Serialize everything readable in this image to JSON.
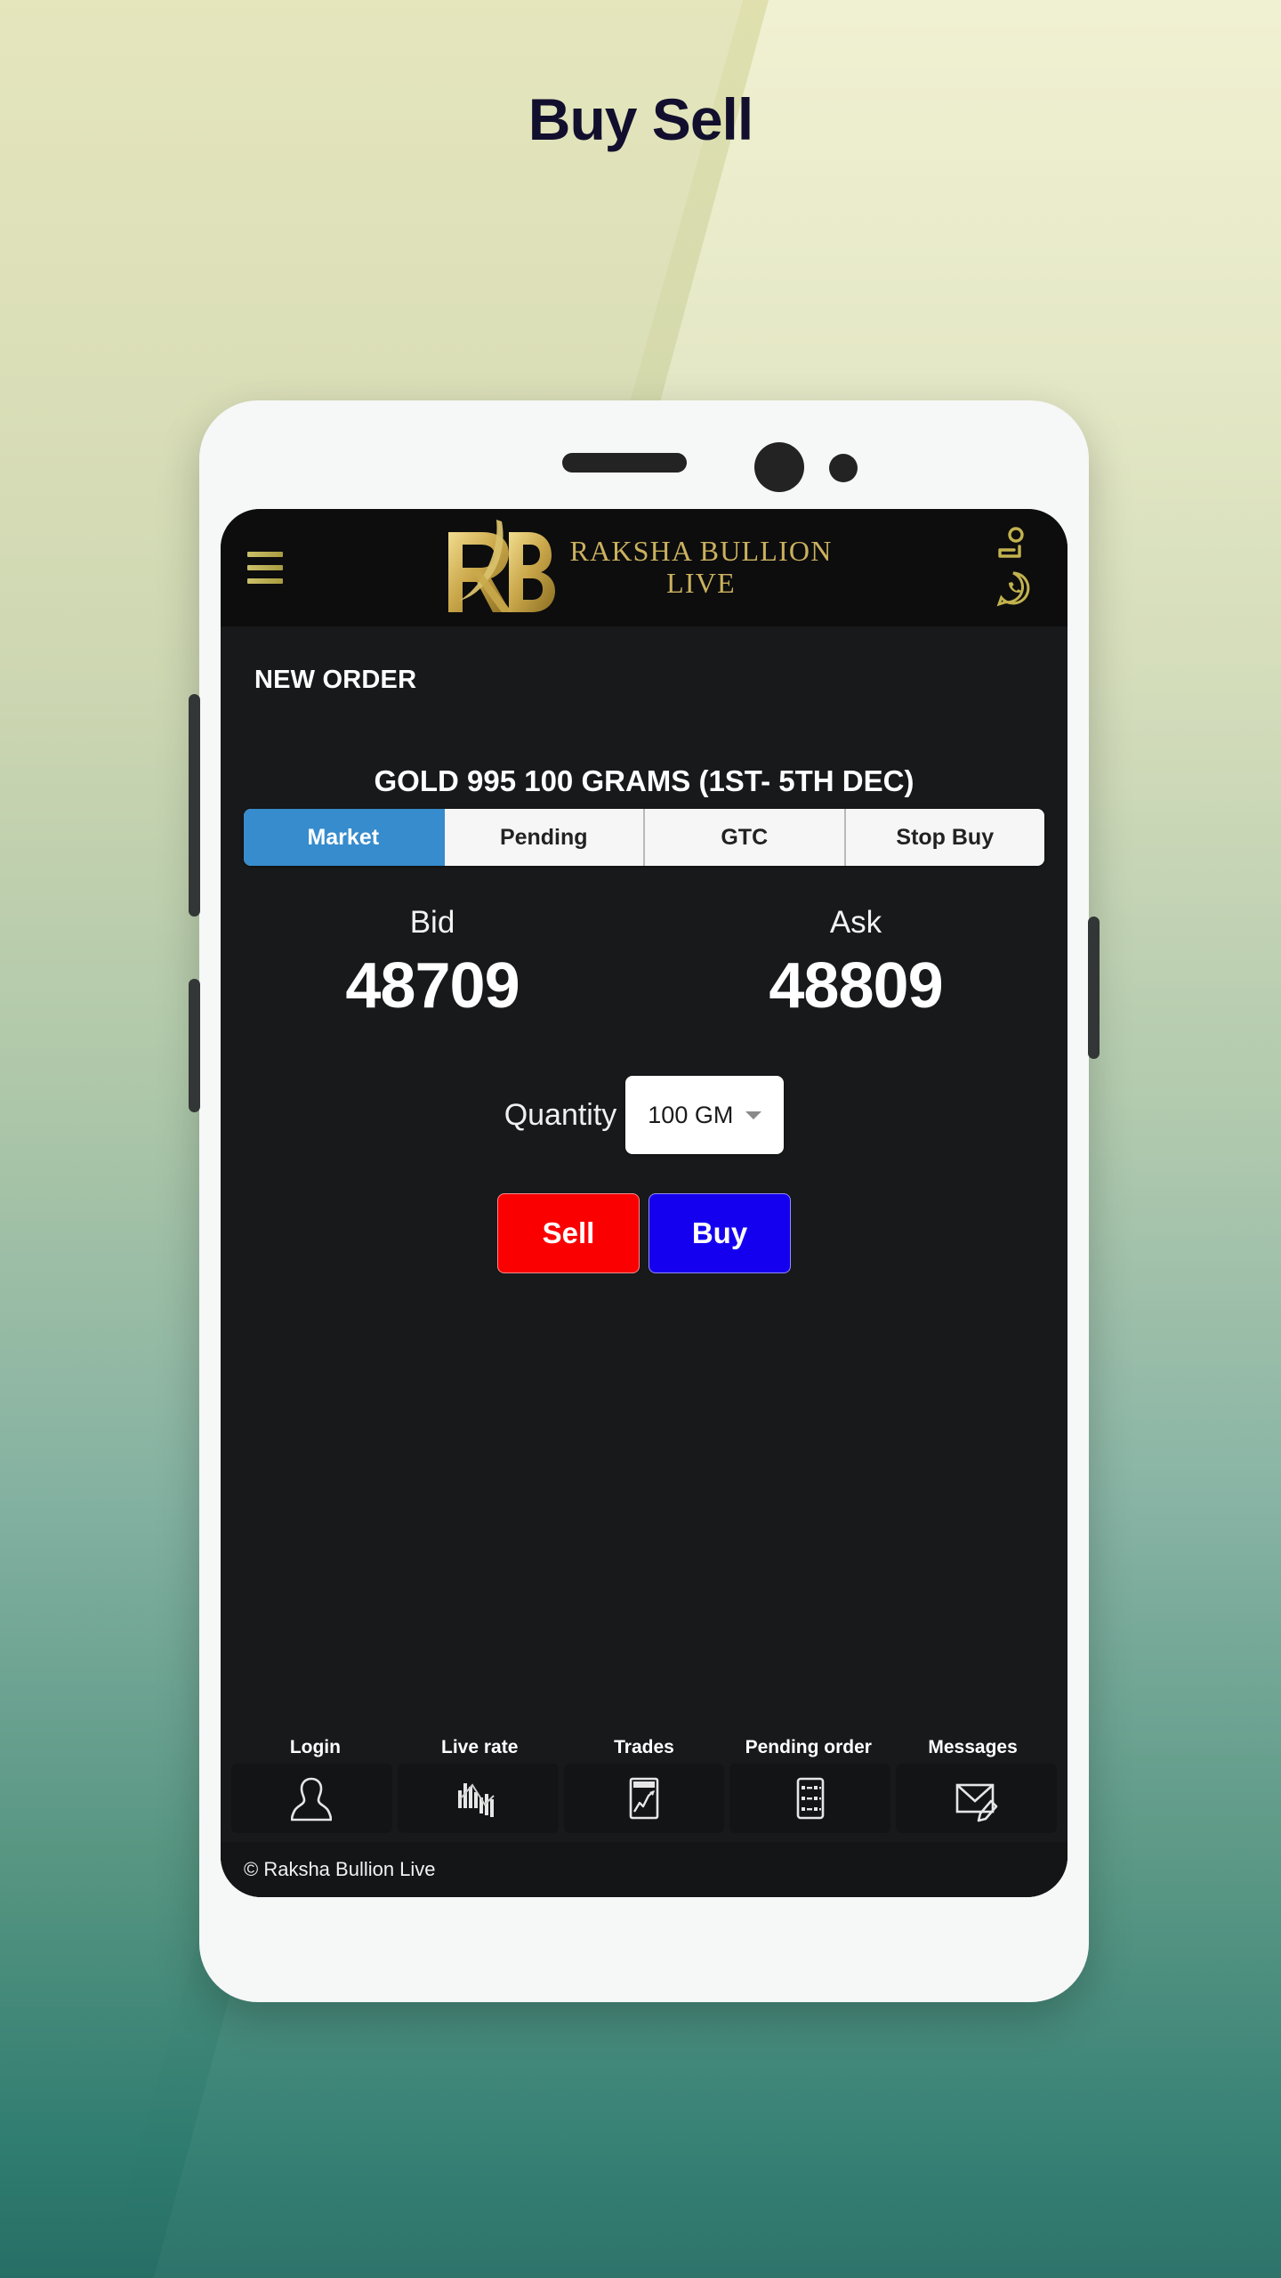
{
  "page": {
    "title": "Buy Sell"
  },
  "app": {
    "brand": {
      "line1": "RAKSHA BULLION",
      "line2": "LIVE",
      "logo_text": "RB"
    },
    "header_icons": [
      {
        "name": "contact-icon"
      },
      {
        "name": "whatsapp-icon"
      }
    ],
    "menu_icon": "hamburger-menu-icon",
    "section_title": "NEW ORDER",
    "product_title": "GOLD 995 100 GRAMS (1ST- 5TH DEC)",
    "tabs": [
      {
        "label": "Market",
        "active": true
      },
      {
        "label": "Pending",
        "active": false
      },
      {
        "label": "GTC",
        "active": false
      },
      {
        "label": "Stop Buy",
        "active": false
      }
    ],
    "prices": {
      "bid_label": "Bid",
      "bid_value": "48709",
      "ask_label": "Ask",
      "ask_value": "48809"
    },
    "quantity": {
      "label": "Quantity",
      "value": "100 GM"
    },
    "actions": {
      "sell_label": "Sell",
      "buy_label": "Buy"
    },
    "bottom_nav": [
      {
        "label": "Login",
        "icon": "person-icon"
      },
      {
        "label": "Live rate",
        "icon": "bar-chart-icon"
      },
      {
        "label": "Trades",
        "icon": "chart-document-icon"
      },
      {
        "label": "Pending order",
        "icon": "list-grid-icon"
      },
      {
        "label": "Messages",
        "icon": "envelope-pencil-icon"
      }
    ],
    "footer": "© Raksha Bullion Live"
  },
  "colors": {
    "accent_blue": "#368ccd",
    "sell_red": "#fb0000",
    "buy_blue": "#1400ef",
    "gold": "#cbb15e",
    "screen_bg": "#17191b",
    "title_ink": "#120f2e"
  }
}
